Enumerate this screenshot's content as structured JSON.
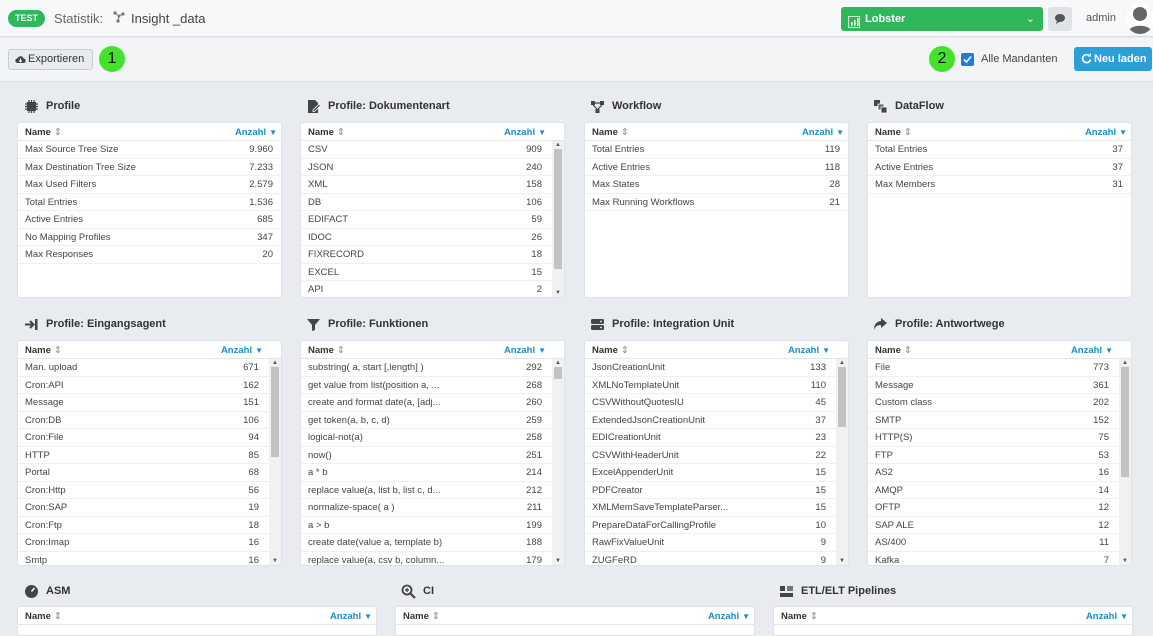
{
  "header": {
    "badge": "TEST",
    "section": "Statistik:",
    "page": "Insight _data",
    "selector": "Lobster",
    "user": "admin"
  },
  "toolbar": {
    "export": "Exportieren",
    "all_clients": "Alle Mandanten",
    "reload": "Neu laden",
    "marker1": "1",
    "marker2": "2"
  },
  "columns": {
    "name": "Name",
    "count": "Anzahl"
  },
  "panels": [
    {
      "title": "Profile",
      "icon": "chip-icon",
      "rows": [
        [
          "Max Source Tree Size",
          "9.960"
        ],
        [
          "Max Destination Tree Size",
          "7.233"
        ],
        [
          "Max Used Filters",
          "2.579"
        ],
        [
          "Total Entries",
          "1.536"
        ],
        [
          "Active Entries",
          "685"
        ],
        [
          "No Mapping Profiles",
          "347"
        ],
        [
          "Max Responses",
          "20"
        ]
      ]
    },
    {
      "title": "Profile: Dokumentenart",
      "icon": "document-icon",
      "rows": [
        [
          "CSV",
          "909"
        ],
        [
          "JSON",
          "240"
        ],
        [
          "XML",
          "158"
        ],
        [
          "DB",
          "106"
        ],
        [
          "EDIFACT",
          "59"
        ],
        [
          "IDOC",
          "26"
        ],
        [
          "FIXRECORD",
          "18"
        ],
        [
          "EXCEL",
          "15"
        ],
        [
          "API",
          "2"
        ]
      ]
    },
    {
      "title": "Workflow",
      "icon": "workflow-icon",
      "rows": [
        [
          "Total Entries",
          "119"
        ],
        [
          "Active Entries",
          "118"
        ],
        [
          "Max States",
          "28"
        ],
        [
          "Max Running Workflows",
          "21"
        ]
      ]
    },
    {
      "title": "DataFlow",
      "icon": "dataflow-icon",
      "rows": [
        [
          "Total Entries",
          "37"
        ],
        [
          "Active Entries",
          "37"
        ],
        [
          "Max Members",
          "31"
        ]
      ]
    },
    {
      "title": "Profile: Eingangsagent",
      "icon": "sign-in-icon",
      "rows": [
        [
          "Man. upload",
          "671"
        ],
        [
          "Cron:API",
          "162"
        ],
        [
          "Message",
          "151"
        ],
        [
          "Cron:DB",
          "106"
        ],
        [
          "Cron:File",
          "94"
        ],
        [
          "HTTP",
          "85"
        ],
        [
          "Portal",
          "68"
        ],
        [
          "Cron:Http",
          "56"
        ],
        [
          "Cron:SAP",
          "19"
        ],
        [
          "Cron:Ftp",
          "18"
        ],
        [
          "Cron:Imap",
          "16"
        ],
        [
          "Smtp",
          "16"
        ]
      ]
    },
    {
      "title": "Profile: Funktionen",
      "icon": "filter-icon",
      "rows": [
        [
          "substring( a, start [,length] )",
          "292"
        ],
        [
          "get value from list(position a, ...",
          "268"
        ],
        [
          "create and format date(a, [adj...",
          "260"
        ],
        [
          "get token(a, b, c, d)",
          "259"
        ],
        [
          "logical-not(a)",
          "258"
        ],
        [
          "now()",
          "251"
        ],
        [
          "a * b",
          "214"
        ],
        [
          "replace value(a, list b, list c, d...",
          "212"
        ],
        [
          "normalize-space( a )",
          "211"
        ],
        [
          "a > b",
          "199"
        ],
        [
          "create date(value a, template b)",
          "188"
        ],
        [
          "replace value(a, csv b, column...",
          "179"
        ]
      ]
    },
    {
      "title": "Profile: Integration Unit",
      "icon": "server-icon",
      "rows": [
        [
          "JsonCreationUnit",
          "133"
        ],
        [
          "XMLNoTemplateUnit",
          "110"
        ],
        [
          "CSVWithoutQuotesIU",
          "45"
        ],
        [
          "ExtendedJsonCreationUnit",
          "37"
        ],
        [
          "EDICreationUnit",
          "23"
        ],
        [
          "CSVWithHeaderUnit",
          "22"
        ],
        [
          "ExcelAppenderUnit",
          "15"
        ],
        [
          "PDFCreator",
          "15"
        ],
        [
          "XMLMemSaveTemplateParser...",
          "15"
        ],
        [
          "PrepareDataForCallingProfile",
          "10"
        ],
        [
          "RawFixValueUnit",
          "9"
        ],
        [
          "ZUGFeRD",
          "9"
        ]
      ]
    },
    {
      "title": "Profile: Antwortwege",
      "icon": "share-icon",
      "rows": [
        [
          "File",
          "773"
        ],
        [
          "Message",
          "361"
        ],
        [
          "Custom class",
          "202"
        ],
        [
          "SMTP",
          "152"
        ],
        [
          "HTTP(S)",
          "75"
        ],
        [
          "FTP",
          "53"
        ],
        [
          "AS2",
          "16"
        ],
        [
          "AMQP",
          "14"
        ],
        [
          "OFTP",
          "12"
        ],
        [
          "SAP ALE",
          "12"
        ],
        [
          "AS/400",
          "11"
        ],
        [
          "Kafka",
          "7"
        ]
      ]
    },
    {
      "title": "ASM",
      "icon": "dashboard-icon",
      "rows": []
    },
    {
      "title": "CI",
      "icon": "search-plus-icon",
      "rows": []
    },
    {
      "title": "ETL/ELT Pipelines",
      "icon": "pipeline-icon",
      "rows": []
    }
  ],
  "colors": {
    "green": "#2fb75b",
    "blue": "#2a9fd8",
    "marker": "#44e22c"
  }
}
